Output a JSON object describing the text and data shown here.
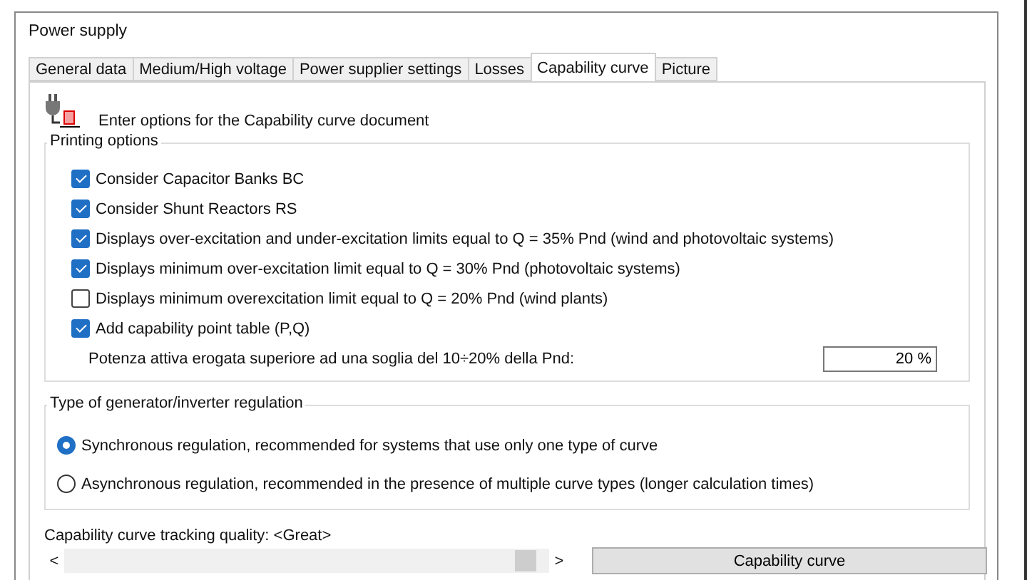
{
  "window": {
    "title": "Power supply"
  },
  "tabs": [
    {
      "label": "General data",
      "selected": false
    },
    {
      "label": "Medium/High voltage",
      "selected": false
    },
    {
      "label": "Power supplier settings",
      "selected": false
    },
    {
      "label": "Losses",
      "selected": false
    },
    {
      "label": "Capability curve",
      "selected": true
    },
    {
      "label": "Picture",
      "selected": false
    }
  ],
  "header": "Enter options for the Capability curve document",
  "printing_options": {
    "title": "Printing options",
    "options": [
      {
        "label": "Consider Capacitor Banks BC",
        "checked": true
      },
      {
        "label": "Consider Shunt Reactors RS",
        "checked": true
      },
      {
        "label": "Displays over-excitation and under-excitation limits equal to Q = 35% Pnd (wind and photovoltaic systems)",
        "checked": true
      },
      {
        "label": "Displays minimum over-excitation limit equal to Q = 30% Pnd (photovoltaic systems)",
        "checked": true
      },
      {
        "label": "Displays minimum overexcitation limit equal to Q = 20% Pnd (wind plants)",
        "checked": false
      },
      {
        "label": "Add capability point table (P,Q)",
        "checked": true
      }
    ],
    "threshold": {
      "label": "Potenza attiva erogata superiore ad una soglia del 10÷20% della Pnd:",
      "value": "20 %"
    }
  },
  "regulation": {
    "title": "Type of generator/inverter regulation",
    "options": [
      {
        "label": "Synchronous regulation, recommended for systems that use only one type of curve",
        "selected": true
      },
      {
        "label": "Asynchronous regulation, recommended in the presence of multiple curve types (longer calculation times)",
        "selected": false
      }
    ]
  },
  "tracking": {
    "label": "Capability curve tracking quality: <Great>",
    "level": 0.95,
    "left_arrow": "<",
    "right_arrow": ">"
  },
  "capability_button": "Capability curve"
}
